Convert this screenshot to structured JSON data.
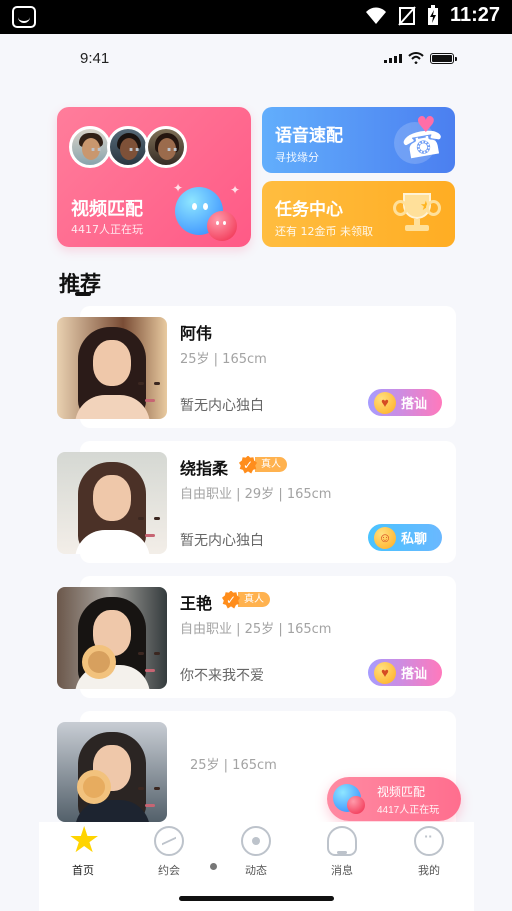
{
  "android_status": {
    "time": "11:27"
  },
  "ios_status": {
    "time": "9:41"
  },
  "feature_cards": {
    "video": {
      "title": "视频匹配",
      "subtitle": "4417人正在玩"
    },
    "voice": {
      "title": "语音速配",
      "subtitle": "寻找缘分"
    },
    "task": {
      "title": "任务中心",
      "subtitle": "还有 12金币 未领取"
    }
  },
  "section": {
    "title": "推荐"
  },
  "profiles": [
    {
      "name": "阿伟",
      "meta": "25岁 | 165cm",
      "bio": "暂无内心独白",
      "action": "搭讪"
    },
    {
      "name": "绕指柔",
      "badge": "真人",
      "meta": "自由职业 | 29岁 | 165cm",
      "bio": "暂无内心独白",
      "action": "私聊"
    },
    {
      "name": "王艳",
      "badge": "真人",
      "meta": "自由职业 | 25岁 | 165cm",
      "bio": "你不来我不爱",
      "action": "搭讪"
    },
    {
      "meta": "25岁 | 165cm"
    }
  ],
  "floating_match": {
    "title": "视频匹配",
    "subtitle": "4417人正在玩"
  },
  "tabbar": [
    {
      "label": "首页",
      "icon": "star-home-icon"
    },
    {
      "label": "约会",
      "icon": "heart-pulse-icon"
    },
    {
      "label": "动态",
      "icon": "eye-circle-icon"
    },
    {
      "label": "消息",
      "icon": "bell-icon"
    },
    {
      "label": "我的",
      "icon": "profile-face-icon"
    }
  ],
  "colors": {
    "pink": "#ff6f96",
    "blue": "#5a98f7",
    "orange": "#ffb329",
    "accent_yellow": "#ffd400"
  }
}
